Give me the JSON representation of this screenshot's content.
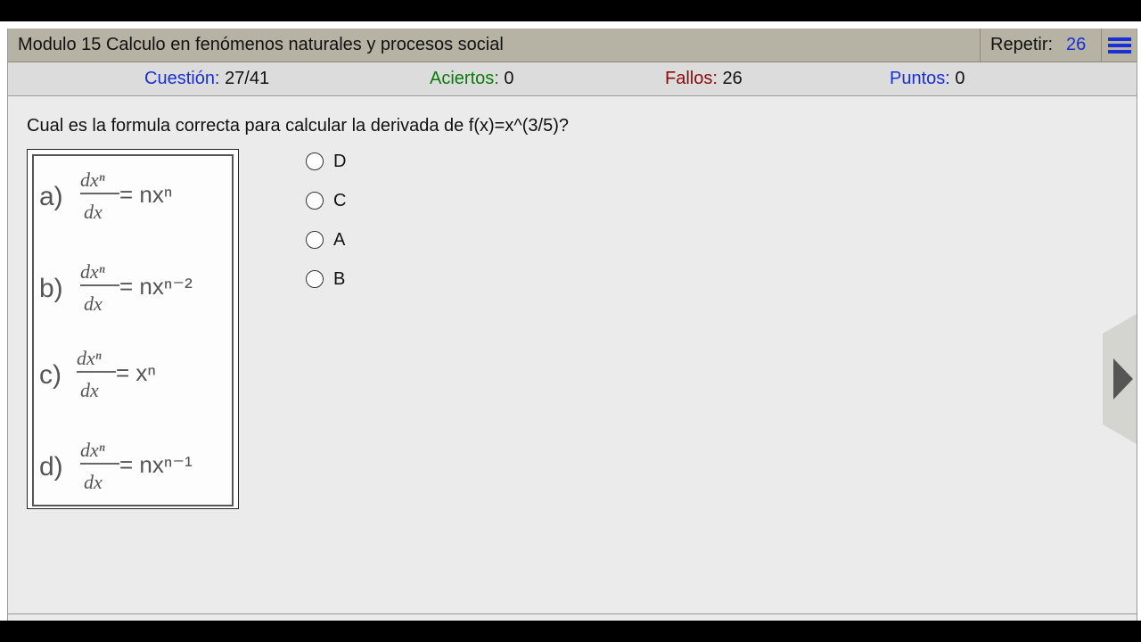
{
  "header": {
    "title": "Modulo 15 Calculo en fenómenos naturales y procesos social",
    "repeat_label": "Repetir:",
    "repeat_value": "26",
    "menu_icon": "hamburger-menu-icon"
  },
  "stats": {
    "question_label": "Cuestión:",
    "question_value": "27/41",
    "correct_label": "Aciertos:",
    "correct_value": "0",
    "wrong_label": "Fallos:",
    "wrong_value": "26",
    "points_label": "Puntos:",
    "points_value": "0"
  },
  "colors": {
    "blue": "#1a2fd8",
    "green": "#0c7a0c",
    "red": "#8b0a0a",
    "header_bg": "#b6b3a5",
    "stats_bg": "#dcdcdc",
    "body_bg": "#ebebeb"
  },
  "question": {
    "text": "Cual es la formula correcta para calcular la derivada de f(x)=x^(3/5)?"
  },
  "formulas": [
    {
      "letter": "a)",
      "numerator": "dxⁿ",
      "denominator": "dx",
      "rhs": "= nxⁿ"
    },
    {
      "letter": "b)",
      "numerator": "dxⁿ",
      "denominator": "dx",
      "rhs": "= nxⁿ⁻²"
    },
    {
      "letter": "c)",
      "numerator": "dxⁿ",
      "denominator": "dx",
      "rhs": "= xⁿ"
    },
    {
      "letter": "d)",
      "numerator": "dxⁿ",
      "denominator": "dx",
      "rhs": "= nxⁿ⁻¹"
    }
  ],
  "options": [
    "D",
    "C",
    "A",
    "B"
  ],
  "next_icon": "next-arrow-icon"
}
